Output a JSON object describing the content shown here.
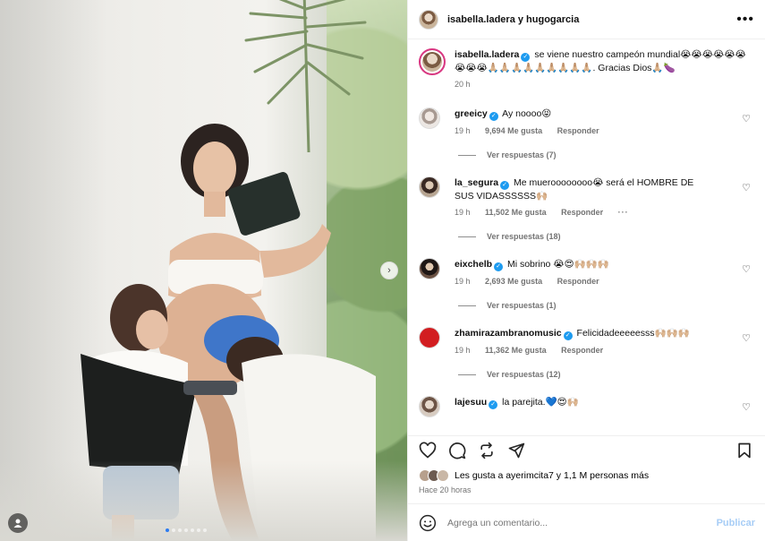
{
  "post": {
    "authors": "isabella.ladera y hugogarcia",
    "more_icon": "ellipsis-icon"
  },
  "caption": {
    "username": "isabella.ladera",
    "text": "se viene nuestro campeón mundial😭😭😭😭😭😭😭😭😭🙏🏼🙏🏼🙏🏼🙏🏼🙏🏼🙏🏼🙏🏼🙏🏼🙏🏼. Gracias Dios🙏🏼🍆",
    "time": "20 h"
  },
  "comments": [
    {
      "username": "greeicy",
      "text": "Ay noooo😝",
      "time": "19 h",
      "likes": "9,694 Me gusta",
      "reply": "Responder",
      "replies": "Ver respuestas (7)"
    },
    {
      "username": "la_segura",
      "text": "Me mueroooooooo😭 será el HOMBRE DE SUS VIDASSSSSS🙌🏼",
      "time": "19 h",
      "likes": "11,502 Me gusta",
      "reply": "Responder",
      "more": "···",
      "replies": "Ver respuestas (18)"
    },
    {
      "username": "eixchelb",
      "text": "Mi sobrino 😭😍🙌🏼🙌🏼🙌🏼",
      "time": "19 h",
      "likes": "2,693 Me gusta",
      "reply": "Responder",
      "replies": "Ver respuestas (1)"
    },
    {
      "username": "zhamirazambranomusic",
      "text": "Felicidadeeeeesss🙌🏼🙌🏼🙌🏼",
      "time": "19 h",
      "likes": "11,362 Me gusta",
      "reply": "Responder",
      "replies": "Ver respuestas (12)"
    },
    {
      "username": "lajesuu",
      "text": "la parejita.💙😍🙌🏼"
    }
  ],
  "actions": {
    "likes_text": "Les gusta a ayerimcita7 y 1,1 M personas más",
    "posted": "Hace 20 horas"
  },
  "add_comment": {
    "placeholder": "Agrega un comentario...",
    "publish": "Publicar"
  },
  "photo": {
    "description_icon": "photo",
    "carousel_next": "›"
  }
}
